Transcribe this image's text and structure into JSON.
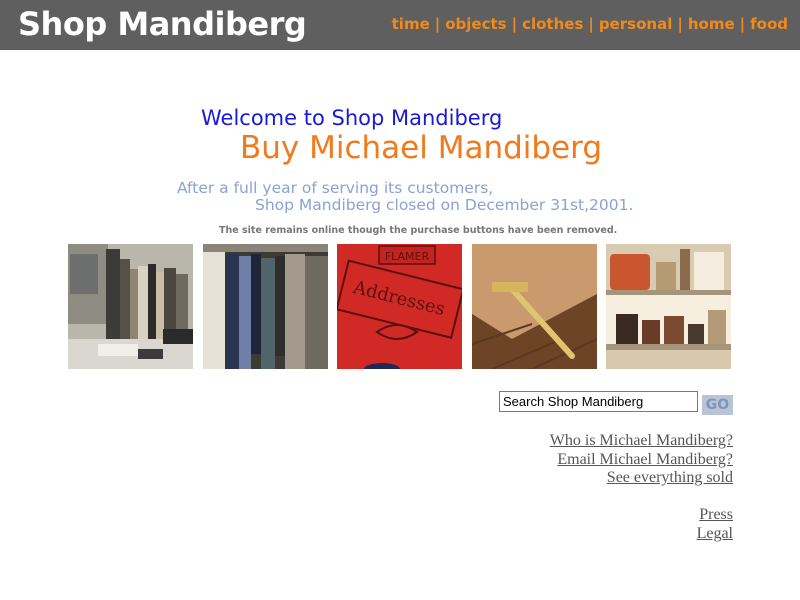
{
  "header": {
    "title": "Shop Mandiberg",
    "nav": [
      "time",
      "objects",
      "clothes",
      "personal",
      "home",
      "food"
    ],
    "separator": "|"
  },
  "intro": {
    "welcome": "Welcome to Shop Mandiberg",
    "buy": "Buy Michael Mandiberg",
    "closed_line1": "After a full year of serving its customers,",
    "closed_line2": "Shop Mandiberg closed on December 31st,2001.",
    "notice": "The site remains online though the purchase buttons have been removed."
  },
  "photos": [
    {
      "subject": "desk with books"
    },
    {
      "subject": "clothes on rack"
    },
    {
      "subject": "red address book",
      "label_top": "FLAMER",
      "label_main": "Addresses"
    },
    {
      "subject": "wooden chair leg on parquet floor"
    },
    {
      "subject": "kitchen shelves with jars"
    }
  ],
  "search": {
    "value": "Search Shop Mandiberg",
    "button_label": "GO"
  },
  "links": {
    "group1": [
      "Who is Michael Mandiberg?",
      "Email Michael Mandiberg?",
      "See everything sold"
    ],
    "group2": [
      "Press",
      "Legal"
    ]
  },
  "colors": {
    "header_bg": "#5f5f5f",
    "nav": "#f08a1c",
    "welcome": "#1a1ad6",
    "buy": "#f07a1c",
    "closed_text": "#8aa3d1"
  }
}
